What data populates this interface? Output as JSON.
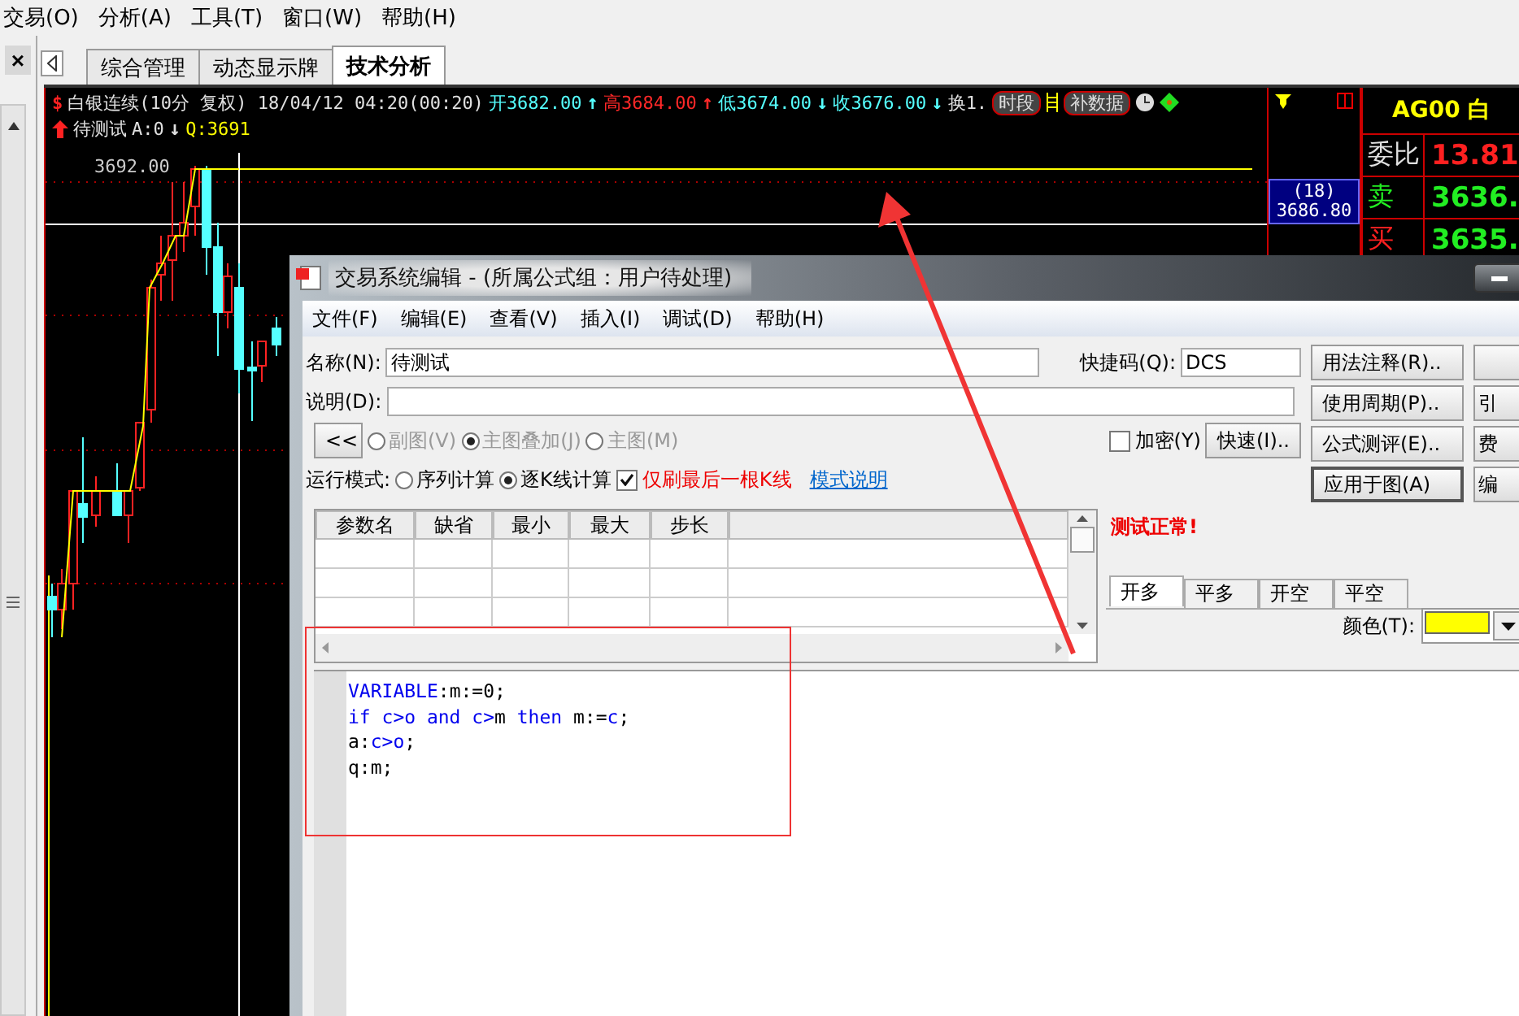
{
  "menu": [
    "交易(O)",
    "分析(A)",
    "工具(T)",
    "窗口(W)",
    "帮助(H)"
  ],
  "side_panel": {
    "close": "×"
  },
  "tabs": [
    {
      "label": "综合管理",
      "selected": false
    },
    {
      "label": "动态显示牌",
      "selected": false
    },
    {
      "label": "技术分析",
      "selected": true
    }
  ],
  "chart": {
    "symbol": "$",
    "title": "白银连续(10分 复权) 18/04/12 04:20(00:20)",
    "quotes": [
      {
        "text": "开3682.00",
        "color": "#55ffff",
        "arrow": "↑"
      },
      {
        "text": "高3684.00",
        "color": "#ff2828",
        "arrow": "↑"
      },
      {
        "text": "低3674.00",
        "color": "#55ffff",
        "arrow": "↓"
      },
      {
        "text": "收3676.00",
        "color": "#55ffff",
        "arrow": "↓"
      },
      {
        "text": "换1.",
        "color": "#e0e0e0"
      }
    ],
    "overlay_buttons": [
      "时段",
      "补数据"
    ],
    "indicator": {
      "name": "待测试",
      "values": [
        {
          "text": "A:0",
          "color": "#e0e0e0",
          "arrow": "↓"
        },
        {
          "text": "Q:3691",
          "color": "#ffff00"
        }
      ]
    },
    "price_label": "3692.00",
    "cursor": {
      "bars": "(18)",
      "price": "3686.80"
    }
  },
  "quote_panel": {
    "code": "AG00 白",
    "rows": [
      {
        "label": "委比",
        "value": "13.81",
        "kind": "ratio"
      },
      {
        "label": "卖",
        "value": "3636.",
        "kind": "sell"
      },
      {
        "label": "买",
        "value": "3635.",
        "kind": "buy"
      }
    ]
  },
  "dialog": {
    "title": "交易系统编辑 - (所属公式组：用户待处理)",
    "menu": [
      "文件(F)",
      "编辑(E)",
      "查看(V)",
      "插入(I)",
      "调试(D)",
      "帮助(H)"
    ],
    "name_label": "名称(N):",
    "name": "待测试",
    "shortcut_label": "快捷码(Q):",
    "shortcut": "DCS",
    "desc_label": "说明(D):",
    "collapse": "<<",
    "chart_modes": [
      {
        "label": "副图(V)",
        "selected": false,
        "disabled": true
      },
      {
        "label": "主图叠加(J)",
        "selected": true,
        "disabled": true
      },
      {
        "label": "主图(M)",
        "selected": false,
        "disabled": true
      }
    ],
    "encrypt": {
      "label": "加密(Y)",
      "checked": false
    },
    "quick": "快速(I)..",
    "run_mode_label": "运行模式:",
    "run_modes": [
      {
        "label": "序列计算",
        "selected": false
      },
      {
        "label": "逐K线计算",
        "selected": true
      }
    ],
    "last_bar_only": {
      "label": "仅刷最后一根K线",
      "checked": true
    },
    "mode_help": "模式说明",
    "buttons": [
      {
        "label": "用法注释(R)..",
        "default": false
      },
      {
        "label": "使用周期(P)..",
        "default": false
      },
      {
        "label": "公式测评(E)..",
        "default": false
      },
      {
        "label": "应用于图(A)",
        "default": true
      }
    ],
    "side_buttons": [
      "引",
      "费",
      "编"
    ],
    "params": {
      "columns": [
        "参数名",
        "缺省",
        "最小",
        "最大",
        "步长"
      ]
    },
    "status": "测试正常!",
    "signal_tabs": [
      {
        "label": "开多",
        "selected": true
      },
      {
        "label": "平多",
        "selected": false
      },
      {
        "label": "开空",
        "selected": false
      },
      {
        "label": "平空",
        "selected": false
      }
    ],
    "color_setting": {
      "label": "颜色(T):",
      "color": "#ffff00"
    },
    "code": [
      [
        {
          "text": "VARIABLE",
          "kind": "keyword"
        },
        {
          "text": ":m:=0;",
          "kind": "plain"
        }
      ],
      [
        {
          "text": "if c>o and c>",
          "kind": "keyword"
        },
        {
          "text": "m",
          "kind": "plain"
        },
        {
          "text": " then",
          "kind": "keyword"
        },
        {
          "text": " m:=",
          "kind": "plain"
        },
        {
          "text": "c",
          "kind": "keyword"
        },
        {
          "text": ";",
          "kind": "plain"
        }
      ],
      [
        {
          "text": "a:",
          "kind": "plain"
        },
        {
          "text": "c>o",
          "kind": "keyword"
        },
        {
          "text": ";",
          "kind": "plain"
        }
      ],
      [
        {
          "text": "q:m;",
          "kind": "plain"
        }
      ]
    ]
  }
}
